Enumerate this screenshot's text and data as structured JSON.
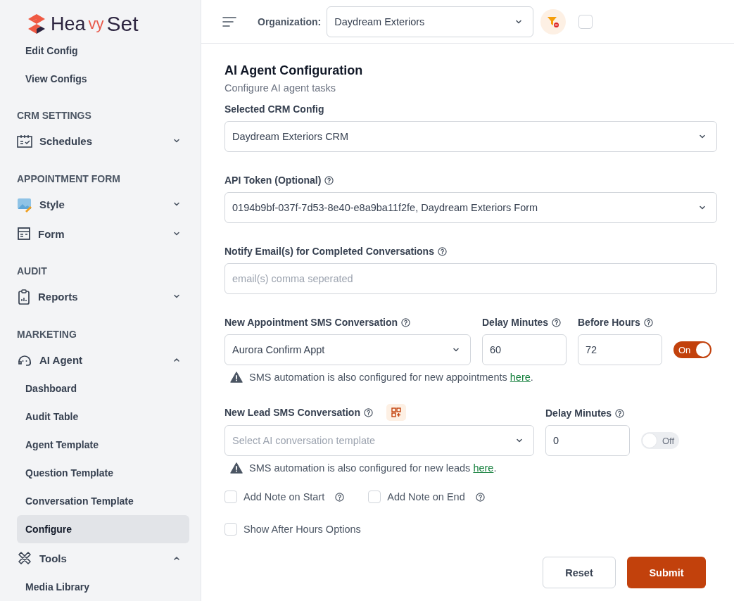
{
  "sidebar": {
    "logo": [
      {
        "text": "Hea",
        "accent": false
      },
      {
        "text": "vy",
        "accent": true
      },
      {
        "text": "Set",
        "accent": false
      }
    ],
    "sections": [
      {
        "items": [
          {
            "kind": "link",
            "label": "Edit Config",
            "selected": false
          },
          {
            "kind": "link",
            "label": "View Configs",
            "selected": false
          }
        ]
      },
      {
        "heading": "CRM SETTINGS",
        "items": [
          {
            "kind": "group",
            "label": "Schedules",
            "expanded": false
          }
        ]
      },
      {
        "heading": "APPOINTMENT FORM",
        "items": [
          {
            "kind": "group",
            "label": "Style",
            "expanded": false
          },
          {
            "kind": "group",
            "label": "Form",
            "expanded": false
          }
        ]
      },
      {
        "heading": "AUDIT",
        "items": [
          {
            "kind": "group",
            "label": "Reports",
            "expanded": false
          }
        ]
      },
      {
        "heading": "MARKETING",
        "items": [
          {
            "kind": "group",
            "label": "AI Agent",
            "expanded": true
          },
          {
            "kind": "link",
            "label": "Dashboard",
            "selected": false
          },
          {
            "kind": "link",
            "label": "Audit Table",
            "selected": false
          },
          {
            "kind": "link",
            "label": "Agent Template",
            "selected": false
          },
          {
            "kind": "link",
            "label": "Question Template",
            "selected": false
          },
          {
            "kind": "link",
            "label": "Conversation Template",
            "selected": false
          },
          {
            "kind": "link",
            "label": "Configure",
            "selected": true
          },
          {
            "kind": "group",
            "label": "Tools",
            "expanded": true
          },
          {
            "kind": "link",
            "label": "Media Library",
            "selected": false
          }
        ]
      }
    ]
  },
  "topbar": {
    "org_label": "Organization:",
    "org_value": "Daydream Exteriors",
    "extra_checkbox": {
      "checked": false
    }
  },
  "page": {
    "title": "AI Agent Configuration",
    "subtitle": "Configure AI agent tasks"
  },
  "crm_config": {
    "label": "Selected CRM Config",
    "value": "Daydream Exteriors CRM"
  },
  "api_token": {
    "label": "API Token (Optional)",
    "value": "0194b9bf-037f-7d53-8e40-e8a9ba11f2fe, Daydream Exteriors Form"
  },
  "notify": {
    "label": "Notify Email(s) for Completed Conversations",
    "placeholder": "email(s) comma seperated"
  },
  "appointment": {
    "label": "New Appointment SMS Conversation",
    "value": "Aurora Confirm Appt",
    "delay": {
      "label": "Delay Minutes",
      "value": "60"
    },
    "before": {
      "label": "Before Hours",
      "value": "72"
    },
    "toggle": {
      "label": "On",
      "on": true
    },
    "warning": {
      "text": "SMS automation is also configured for new appointments",
      "link": "here",
      "tail": "."
    }
  },
  "lead": {
    "label": "New Lead SMS Conversation",
    "placeholder": "Select AI conversation template",
    "delay": {
      "label": "Delay Minutes",
      "value": "0"
    },
    "toggle": {
      "label": "Off",
      "on": false
    },
    "warning": {
      "text": "SMS automation is also configured for new leads",
      "link": "here",
      "tail": "."
    }
  },
  "checkboxes": [
    {
      "label": "Add Note on Start",
      "checked": false,
      "help": true
    },
    {
      "label": "Add Note on End",
      "checked": false,
      "help": true
    },
    {
      "label": "Show After Hours Options",
      "checked": false,
      "help": false
    }
  ],
  "buttons": {
    "reset": "Reset",
    "submit": "Submit"
  }
}
